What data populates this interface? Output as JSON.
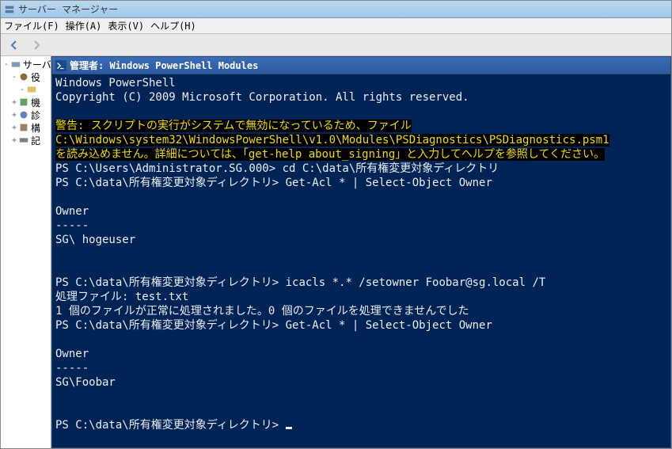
{
  "outer_window": {
    "title": "サーバー マネージャー"
  },
  "menu": {
    "file": "ファイル(F)",
    "action": "操作(A)",
    "view": "表示(V)",
    "help": "ヘルプ(H)"
  },
  "tree": {
    "items": [
      {
        "label": "サーバ",
        "toggle": "-"
      },
      {
        "label": "役",
        "toggle": "-"
      },
      {
        "label": "",
        "toggle": "-"
      },
      {
        "label": "機",
        "toggle": "+"
      },
      {
        "label": "診",
        "toggle": "+"
      },
      {
        "label": "構",
        "toggle": "+"
      },
      {
        "label": "記",
        "toggle": "+"
      }
    ]
  },
  "ps_window": {
    "title": "管理者: Windows PowerShell Modules"
  },
  "console": {
    "lines": [
      {
        "t": "Windows PowerShell"
      },
      {
        "t": "Copyright (C) 2009 Microsoft Corporation. All rights reserved."
      },
      {
        "t": ""
      },
      {
        "style": "yellow",
        "t": "警告: スクリプトの実行がシステムで無効になっているため、ファイル"
      },
      {
        "style": "yellow",
        "t": "C:\\Windows\\system32\\WindowsPowerShell\\v1.0\\Modules\\PSDiagnostics\\PSDiagnostics.psm1"
      },
      {
        "style": "yellow",
        "t": "を読み込めません。詳細については、「get-help about_signing」と入力してヘルプを参照してください。"
      },
      {
        "t": "PS C:\\Users\\Administrator.SG.000> cd C:\\data\\所有権変更対象ディレクトリ"
      },
      {
        "t": "PS C:\\data\\所有権変更対象ディレクトリ> Get-Acl * | Select-Object Owner"
      },
      {
        "t": ""
      },
      {
        "t": "Owner"
      },
      {
        "t": "-----"
      },
      {
        "t": "SG\\ hogeuser"
      },
      {
        "t": ""
      },
      {
        "t": ""
      },
      {
        "t": "PS C:\\data\\所有権変更対象ディレクトリ> icacls *.* /setowner Foobar@sg.local /T"
      },
      {
        "t": "処理ファイル: test.txt"
      },
      {
        "t": "1 個のファイルが正常に処理されました。0 個のファイルを処理できませんでした"
      },
      {
        "t": "PS C:\\data\\所有権変更対象ディレクトリ> Get-Acl * | Select-Object Owner"
      },
      {
        "t": ""
      },
      {
        "t": "Owner"
      },
      {
        "t": "-----"
      },
      {
        "t": "SG\\Foobar"
      },
      {
        "t": ""
      },
      {
        "t": ""
      },
      {
        "prompt": "PS C:\\data\\所有権変更対象ディレクトリ> ",
        "cursor": true
      }
    ]
  }
}
